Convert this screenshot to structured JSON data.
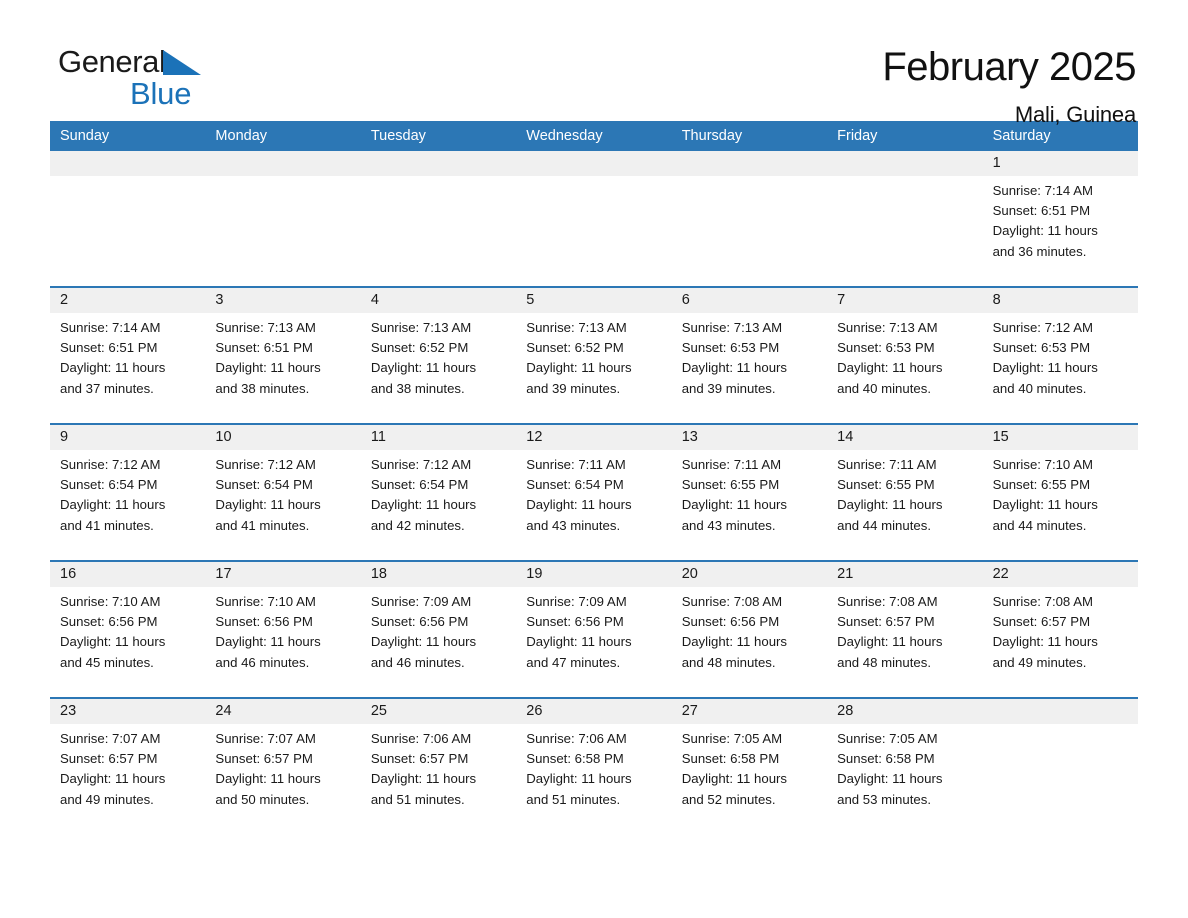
{
  "brand": {
    "name_part1": "General",
    "name_part2": "Blue",
    "triangle_icon": "triangle-icon",
    "accent_color": "#1b72b8"
  },
  "header": {
    "title": "February 2025",
    "location": "Mali, Guinea",
    "header_bg_color": "#2c77b5",
    "row_divider_color": "#2c77b5",
    "datebar_bg_color": "#f0f0f0"
  },
  "weekdays": [
    "Sunday",
    "Monday",
    "Tuesday",
    "Wednesday",
    "Thursday",
    "Friday",
    "Saturday"
  ],
  "labels": {
    "sunrise_prefix": "Sunrise:",
    "sunset_prefix": "Sunset:",
    "daylight_prefix": "Daylight:"
  },
  "weeks": [
    {
      "days": [
        {
          "date": "",
          "empty": true
        },
        {
          "date": "",
          "empty": true
        },
        {
          "date": "",
          "empty": true
        },
        {
          "date": "",
          "empty": true
        },
        {
          "date": "",
          "empty": true
        },
        {
          "date": "",
          "empty": true
        },
        {
          "date": "1",
          "sunrise": "Sunrise: 7:14 AM",
          "sunset": "Sunset: 6:51 PM",
          "daylight_l1": "Daylight: 11 hours",
          "daylight_l2": "and 36 minutes."
        }
      ]
    },
    {
      "days": [
        {
          "date": "2",
          "sunrise": "Sunrise: 7:14 AM",
          "sunset": "Sunset: 6:51 PM",
          "daylight_l1": "Daylight: 11 hours",
          "daylight_l2": "and 37 minutes."
        },
        {
          "date": "3",
          "sunrise": "Sunrise: 7:13 AM",
          "sunset": "Sunset: 6:51 PM",
          "daylight_l1": "Daylight: 11 hours",
          "daylight_l2": "and 38 minutes."
        },
        {
          "date": "4",
          "sunrise": "Sunrise: 7:13 AM",
          "sunset": "Sunset: 6:52 PM",
          "daylight_l1": "Daylight: 11 hours",
          "daylight_l2": "and 38 minutes."
        },
        {
          "date": "5",
          "sunrise": "Sunrise: 7:13 AM",
          "sunset": "Sunset: 6:52 PM",
          "daylight_l1": "Daylight: 11 hours",
          "daylight_l2": "and 39 minutes."
        },
        {
          "date": "6",
          "sunrise": "Sunrise: 7:13 AM",
          "sunset": "Sunset: 6:53 PM",
          "daylight_l1": "Daylight: 11 hours",
          "daylight_l2": "and 39 minutes."
        },
        {
          "date": "7",
          "sunrise": "Sunrise: 7:13 AM",
          "sunset": "Sunset: 6:53 PM",
          "daylight_l1": "Daylight: 11 hours",
          "daylight_l2": "and 40 minutes."
        },
        {
          "date": "8",
          "sunrise": "Sunrise: 7:12 AM",
          "sunset": "Sunset: 6:53 PM",
          "daylight_l1": "Daylight: 11 hours",
          "daylight_l2": "and 40 minutes."
        }
      ]
    },
    {
      "days": [
        {
          "date": "9",
          "sunrise": "Sunrise: 7:12 AM",
          "sunset": "Sunset: 6:54 PM",
          "daylight_l1": "Daylight: 11 hours",
          "daylight_l2": "and 41 minutes."
        },
        {
          "date": "10",
          "sunrise": "Sunrise: 7:12 AM",
          "sunset": "Sunset: 6:54 PM",
          "daylight_l1": "Daylight: 11 hours",
          "daylight_l2": "and 41 minutes."
        },
        {
          "date": "11",
          "sunrise": "Sunrise: 7:12 AM",
          "sunset": "Sunset: 6:54 PM",
          "daylight_l1": "Daylight: 11 hours",
          "daylight_l2": "and 42 minutes."
        },
        {
          "date": "12",
          "sunrise": "Sunrise: 7:11 AM",
          "sunset": "Sunset: 6:54 PM",
          "daylight_l1": "Daylight: 11 hours",
          "daylight_l2": "and 43 minutes."
        },
        {
          "date": "13",
          "sunrise": "Sunrise: 7:11 AM",
          "sunset": "Sunset: 6:55 PM",
          "daylight_l1": "Daylight: 11 hours",
          "daylight_l2": "and 43 minutes."
        },
        {
          "date": "14",
          "sunrise": "Sunrise: 7:11 AM",
          "sunset": "Sunset: 6:55 PM",
          "daylight_l1": "Daylight: 11 hours",
          "daylight_l2": "and 44 minutes."
        },
        {
          "date": "15",
          "sunrise": "Sunrise: 7:10 AM",
          "sunset": "Sunset: 6:55 PM",
          "daylight_l1": "Daylight: 11 hours",
          "daylight_l2": "and 44 minutes."
        }
      ]
    },
    {
      "days": [
        {
          "date": "16",
          "sunrise": "Sunrise: 7:10 AM",
          "sunset": "Sunset: 6:56 PM",
          "daylight_l1": "Daylight: 11 hours",
          "daylight_l2": "and 45 minutes."
        },
        {
          "date": "17",
          "sunrise": "Sunrise: 7:10 AM",
          "sunset": "Sunset: 6:56 PM",
          "daylight_l1": "Daylight: 11 hours",
          "daylight_l2": "and 46 minutes."
        },
        {
          "date": "18",
          "sunrise": "Sunrise: 7:09 AM",
          "sunset": "Sunset: 6:56 PM",
          "daylight_l1": "Daylight: 11 hours",
          "daylight_l2": "and 46 minutes."
        },
        {
          "date": "19",
          "sunrise": "Sunrise: 7:09 AM",
          "sunset": "Sunset: 6:56 PM",
          "daylight_l1": "Daylight: 11 hours",
          "daylight_l2": "and 47 minutes."
        },
        {
          "date": "20",
          "sunrise": "Sunrise: 7:08 AM",
          "sunset": "Sunset: 6:56 PM",
          "daylight_l1": "Daylight: 11 hours",
          "daylight_l2": "and 48 minutes."
        },
        {
          "date": "21",
          "sunrise": "Sunrise: 7:08 AM",
          "sunset": "Sunset: 6:57 PM",
          "daylight_l1": "Daylight: 11 hours",
          "daylight_l2": "and 48 minutes."
        },
        {
          "date": "22",
          "sunrise": "Sunrise: 7:08 AM",
          "sunset": "Sunset: 6:57 PM",
          "daylight_l1": "Daylight: 11 hours",
          "daylight_l2": "and 49 minutes."
        }
      ]
    },
    {
      "days": [
        {
          "date": "23",
          "sunrise": "Sunrise: 7:07 AM",
          "sunset": "Sunset: 6:57 PM",
          "daylight_l1": "Daylight: 11 hours",
          "daylight_l2": "and 49 minutes."
        },
        {
          "date": "24",
          "sunrise": "Sunrise: 7:07 AM",
          "sunset": "Sunset: 6:57 PM",
          "daylight_l1": "Daylight: 11 hours",
          "daylight_l2": "and 50 minutes."
        },
        {
          "date": "25",
          "sunrise": "Sunrise: 7:06 AM",
          "sunset": "Sunset: 6:57 PM",
          "daylight_l1": "Daylight: 11 hours",
          "daylight_l2": "and 51 minutes."
        },
        {
          "date": "26",
          "sunrise": "Sunrise: 7:06 AM",
          "sunset": "Sunset: 6:58 PM",
          "daylight_l1": "Daylight: 11 hours",
          "daylight_l2": "and 51 minutes."
        },
        {
          "date": "27",
          "sunrise": "Sunrise: 7:05 AM",
          "sunset": "Sunset: 6:58 PM",
          "daylight_l1": "Daylight: 11 hours",
          "daylight_l2": "and 52 minutes."
        },
        {
          "date": "28",
          "sunrise": "Sunrise: 7:05 AM",
          "sunset": "Sunset: 6:58 PM",
          "daylight_l1": "Daylight: 11 hours",
          "daylight_l2": "and 53 minutes."
        },
        {
          "date": "",
          "empty": true
        }
      ]
    }
  ]
}
